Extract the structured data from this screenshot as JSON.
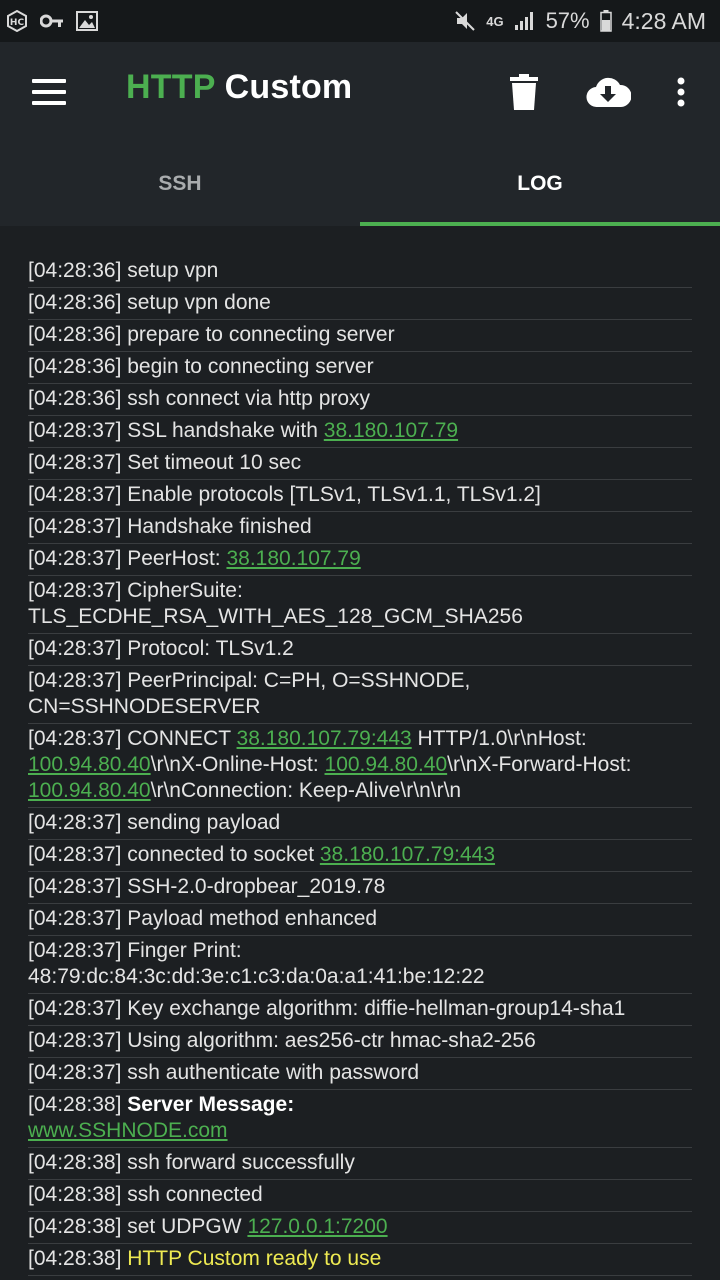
{
  "status_bar": {
    "left_icons": [
      "hc-icon",
      "key-icon",
      "image-icon"
    ],
    "network": "4G",
    "battery": "57%",
    "time": "4:28 AM"
  },
  "app_bar": {
    "title_part1": "HTTP",
    "title_part2": " Custom",
    "actions": [
      "delete-icon",
      "cloud-download-icon",
      "more-vert-icon"
    ]
  },
  "tabs": [
    {
      "label": "SSH",
      "active": false
    },
    {
      "label": "LOG",
      "active": true
    }
  ],
  "colors": {
    "accent": "#4caf50",
    "highlight": "#eeea52",
    "background": "#1c1f22"
  },
  "log": [
    {
      "t": "[04:28:36] ",
      "msg": "setup vpn"
    },
    {
      "t": "[04:28:36] ",
      "msg": "setup vpn done"
    },
    {
      "t": "[04:28:36] ",
      "msg": "prepare to connecting server"
    },
    {
      "t": "[04:28:36] ",
      "msg": "begin to connecting server"
    },
    {
      "t": "[04:28:36] ",
      "msg": "ssh connect via http proxy"
    },
    {
      "t": "[04:28:37] ",
      "msg": "SSL handshake with ",
      "link": "38.180.107.79"
    },
    {
      "t": "[04:28:37] ",
      "msg": "Set timeout 10 sec"
    },
    {
      "t": "[04:28:37] ",
      "msg": "Enable protocols [TLSv1, TLSv1.1, TLSv1.2]"
    },
    {
      "t": "[04:28:37] ",
      "msg": "Handshake finished"
    },
    {
      "t": "[04:28:37] ",
      "msg": "PeerHost: ",
      "link": "38.180.107.79"
    },
    {
      "t": "[04:28:37] ",
      "msg": "CipherSuite: TLS_ECDHE_RSA_WITH_AES_128_GCM_SHA256"
    },
    {
      "t": "[04:28:37] ",
      "msg": "Protocol: TLSv1.2"
    },
    {
      "t": "[04:28:37] ",
      "msg": "PeerPrincipal: C=PH, O=SSHNODE, CN=SSHNODESERVER"
    },
    {
      "t": "[04:28:37] ",
      "connect": {
        "a": "CONNECT ",
        "l1": "38.180.107.79:443",
        "b": " HTTP/1.0\\r\\nHost: ",
        "l2": "100.94.80.40",
        "c": "\\r\\nX-Online-Host: ",
        "l3": "100.94.80.40",
        "d": "\\r\\nX-Forward-Host: ",
        "l4": "100.94.80.40",
        "e": "\\r\\nConnection: Keep-Alive\\r\\n\\r\\n"
      }
    },
    {
      "t": "[04:28:37] ",
      "msg": "sending payload"
    },
    {
      "t": "[04:28:37] ",
      "msg": "connected to socket ",
      "link": "38.180.107.79:443"
    },
    {
      "t": "[04:28:37] ",
      "msg": "SSH-2.0-dropbear_2019.78"
    },
    {
      "t": "[04:28:37] ",
      "msg": "Payload method enhanced"
    },
    {
      "t": "[04:28:37] ",
      "msg": "Finger Print: 48:79:dc:84:3c:dd:3e:c1:c3:da:0a:a1:41:be:12:22"
    },
    {
      "t": "[04:28:37] ",
      "msg": "Key exchange algorithm: diffie-hellman-group14-sha1"
    },
    {
      "t": "[04:28:37] ",
      "msg": "Using algorithm: aes256-ctr hmac-sha2-256"
    },
    {
      "t": "[04:28:37] ",
      "msg": "ssh authenticate with password"
    },
    {
      "t": "[04:28:38] ",
      "bold": "Server Message:",
      "link": "www.SSHNODE.com"
    },
    {
      "t": "[04:28:38] ",
      "msg": "ssh forward successfully"
    },
    {
      "t": "[04:28:38] ",
      "msg": "ssh connected"
    },
    {
      "t": "[04:28:38] ",
      "msg": "set UDPGW ",
      "link": "127.0.0.1:7200"
    },
    {
      "t": "[04:28:38] ",
      "yellow": "HTTP Custom ready to use"
    }
  ]
}
